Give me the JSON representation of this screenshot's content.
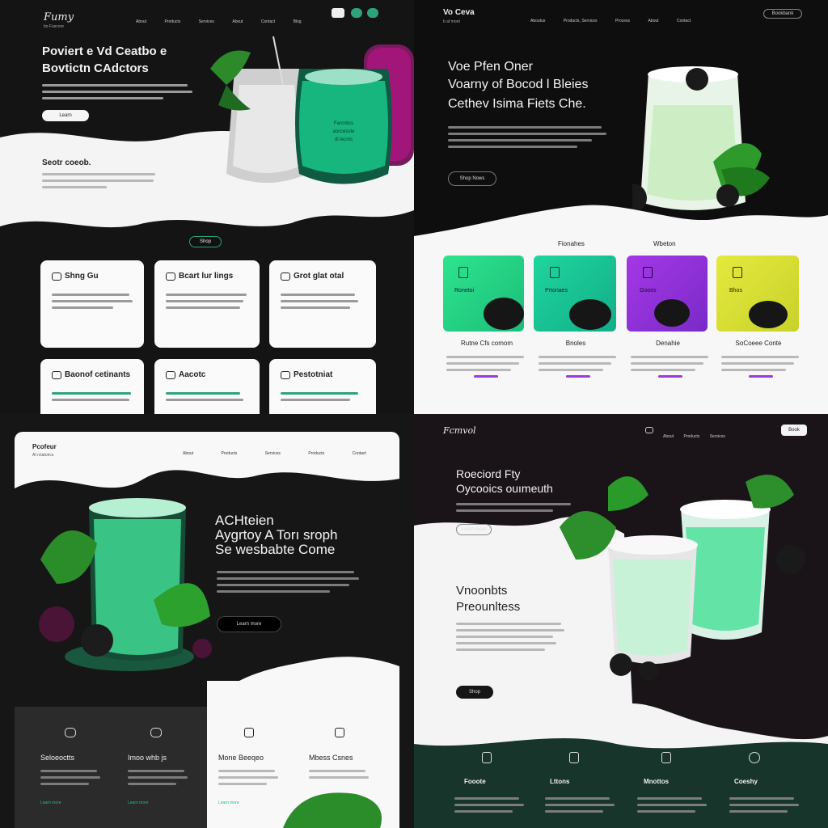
{
  "q1": {
    "logo": "Fumy",
    "logo_sub": "bo Fuscore",
    "nav": [
      "About",
      "Products",
      "Services",
      "About",
      "Contact",
      "Blog"
    ],
    "hero_title_1": "Poviert e Vd Ceatbo e",
    "hero_title_2": "Bovtictn CAdctors",
    "hero_btn": "Learn",
    "glass_text_1": "Farcntics",
    "glass_text_2": "aoccesste",
    "glass_text_3": "di tecnis",
    "section_title": "Seotr coeob.",
    "center_btn": "Shop",
    "cards": [
      "Shng Gu",
      "Bcart lur lings",
      "Grot glat otal",
      "Baonof cetinants",
      "Aacotc",
      "Pestotniat"
    ],
    "colors": {
      "accent": "#2ea37a",
      "green": "#16b67e",
      "magenta": "#c1148e"
    }
  },
  "q2": {
    "logo": "Vo Ceva",
    "logo_sub": "b af mont",
    "nav": [
      "Aboutus",
      "Products, Services",
      "Process",
      "About",
      "Contact"
    ],
    "nav_btn": "Bookbank",
    "hero_title": [
      "Voe Pfen Oner",
      "Voarny of Bocod l Bleies",
      "Cethev Isima Fiets Che."
    ],
    "hero_btn": "Shop Nows",
    "section_headers": [
      "Fionahes",
      "Wbeton"
    ],
    "tiles": [
      {
        "label": "Ronetoi",
        "title": "Rutne Cfs comom",
        "color": "#2ee48e"
      },
      {
        "label": "Prtonaes",
        "title": "Bnoles",
        "color": "#19c497"
      },
      {
        "label": "Gooes",
        "title": "Denahie",
        "color": "#9d38e6"
      },
      {
        "label": "Bhos",
        "title": "SoCoeee Conte",
        "color": "#d9e53a"
      }
    ]
  },
  "q3": {
    "logo": "Pcofeur",
    "logo_sub": "AI rctatorics",
    "nav": [
      "About",
      "Products",
      "Services",
      "Products",
      "Contact"
    ],
    "hero_title": [
      "ACHteien",
      "Aygrtoy A Torı sroph",
      "Se wesbabte Come"
    ],
    "hero_btn": "Learn more",
    "features": [
      {
        "title": "Seloeoctts",
        "link": "Learn more"
      },
      {
        "title": "Imoo whb js",
        "link": "Learn more"
      },
      {
        "title": "Mone Beeqeo",
        "link": "Learn more"
      },
      {
        "title": "Mbess Csnes",
        "link": ""
      }
    ]
  },
  "q4": {
    "logo": "Fcmvol",
    "nav": [
      "About",
      "Products",
      "Services"
    ],
    "nav_btn": "Book",
    "hero_title": [
      "Roeciord Fty",
      "Oycooics ouımeuth"
    ],
    "hero_btn": "Learn more",
    "section_title": [
      "Vnoonbts",
      "Preounltess"
    ],
    "section_btn": "Shop",
    "features": [
      "Fooote",
      "Lttons",
      "Mnottos",
      "Coeshy"
    ]
  }
}
